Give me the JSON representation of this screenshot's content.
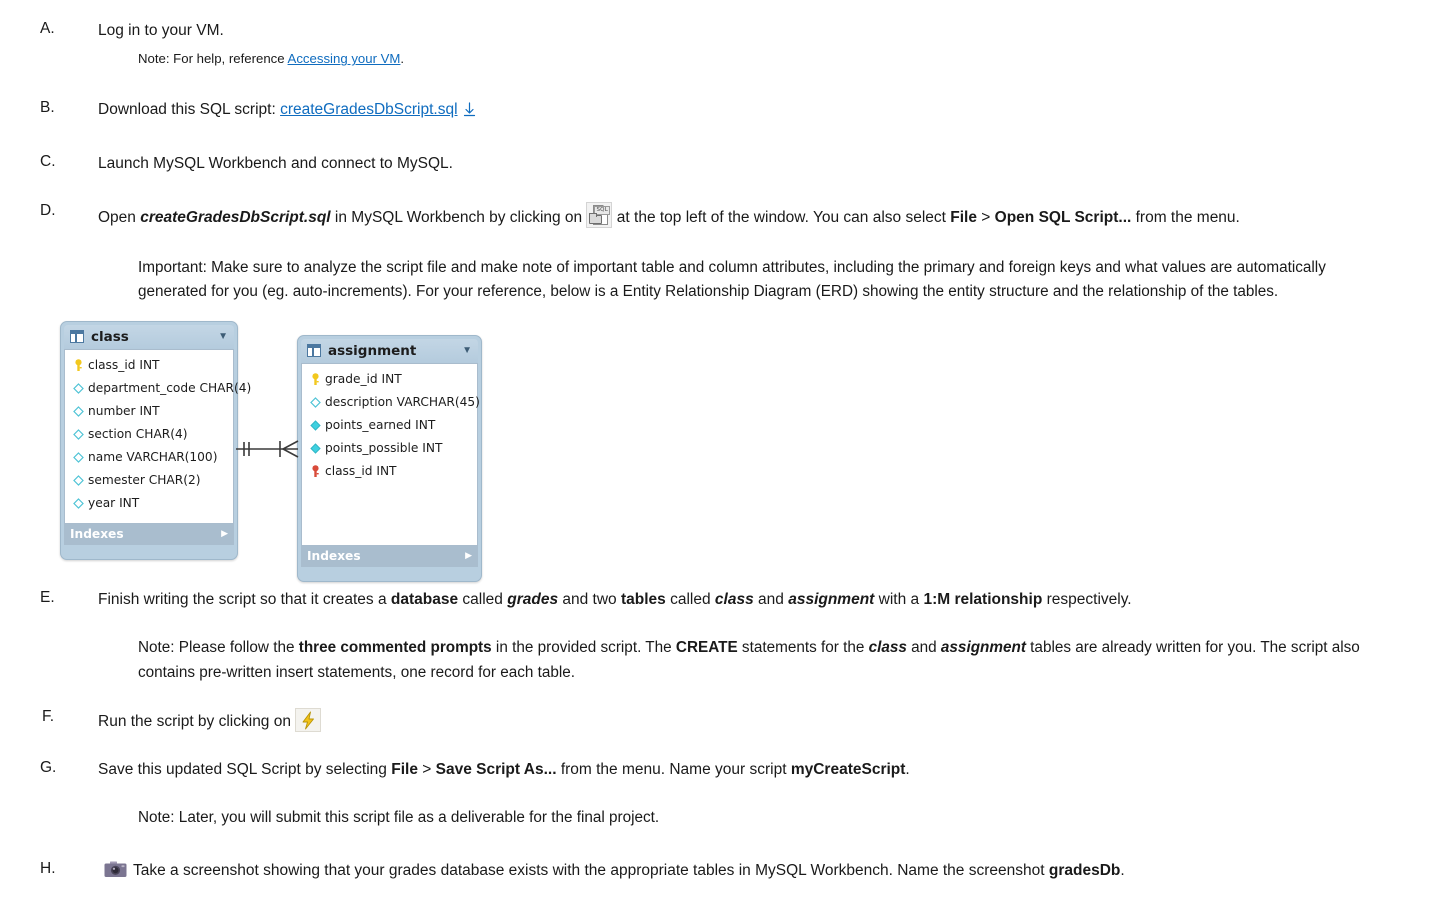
{
  "document": {
    "steps": [
      {
        "letter": "A.",
        "text": "Log in to your VM.",
        "note_prefix": "Note: For help, reference ",
        "note_link": "Accessing your VM",
        "note_suffix": "."
      },
      {
        "letter": "B.",
        "text_prefix": "Download this SQL script: ",
        "link": "createGradesDbScript.sql",
        "download_icon": "download-arrow-icon"
      },
      {
        "letter": "C.",
        "text": "Launch MySQL Workbench and connect to MySQL."
      },
      {
        "letter": "D.",
        "p1": "Open ",
        "file": "createGradesDbScript.sql",
        "p2": " in MySQL Workbench by clicking on ",
        "icon": "open-sql-script-icon",
        "p3": " at the top left of the window. You can also select ",
        "menu1": "File",
        "sep": " > ",
        "menu2": "Open SQL Script...",
        "p4": " from the menu.",
        "important": "Important: Make sure to analyze the script file and make note of important table and column attributes, including the primary and foreign keys and what values are automatically generated for you (eg. auto-increments). For your reference, below is a Entity Relationship Diagram (ERD) showing the entity structure and the relationship of the tables."
      },
      {
        "letter": "E.",
        "p1": "Finish writing the script so that it creates a ",
        "b1": "database",
        "p2": " called ",
        "i1": "grades",
        "p3": " and two ",
        "b2": "tables",
        "p4": " called ",
        "i2": "class",
        "p5": " and ",
        "i3": "assignment",
        "p6": " with a ",
        "b3": "1:M relationship",
        "p7": " respectively.",
        "note_p1": "Note: Please follow the ",
        "note_b1": "three commented prompts",
        "note_p2": " in the provided script. The ",
        "note_b2": "CREATE",
        "note_p3": " statements for the ",
        "note_i1": "class",
        "note_p4": " and ",
        "note_i2": "assignment",
        "note_p5": " tables are already written for you. The script also contains pre-written insert statements, one record for each table."
      },
      {
        "letter": "F.",
        "text": "Run the script by clicking on ",
        "icon": "run-script-lightning-icon"
      },
      {
        "letter": "G.",
        "p1": "Save this updated SQL Script by selecting ",
        "menu1": "File",
        "sep": " > ",
        "menu2": "Save Script As...",
        "p2": " from the menu. Name your script ",
        "b1": "myCreateScript",
        "p3": ".",
        "note": "Note: Later, you will submit this script file as a deliverable for the final project."
      },
      {
        "letter": "H.",
        "icon": "camera-icon",
        "p1": "Take a screenshot showing that your grades database exists with the appropriate tables in MySQL Workbench. Name the screenshot ",
        "b1": "gradesDb",
        "p2": "."
      }
    ]
  },
  "erd": {
    "relationship_notation": "one-to-many-crowsfoot",
    "tables": [
      {
        "name": "class",
        "caret": "▼",
        "indexes_label": "Indexes",
        "indexes_caret": "▶",
        "columns": [
          {
            "name": "class_id INT",
            "key": "primary"
          },
          {
            "name": "department_code CHAR(4)",
            "key": "nullable"
          },
          {
            "name": "number INT",
            "key": "nullable"
          },
          {
            "name": "section CHAR(4)",
            "key": "nullable"
          },
          {
            "name": "name VARCHAR(100)",
            "key": "nullable"
          },
          {
            "name": "semester CHAR(2)",
            "key": "nullable"
          },
          {
            "name": "year INT",
            "key": "nullable"
          }
        ]
      },
      {
        "name": "assignment",
        "caret": "▼",
        "indexes_label": "Indexes",
        "indexes_caret": "▶",
        "columns": [
          {
            "name": "grade_id INT",
            "key": "primary"
          },
          {
            "name": "description VARCHAR(45)",
            "key": "nullable"
          },
          {
            "name": "points_earned INT",
            "key": "notnull"
          },
          {
            "name": "points_possible INT",
            "key": "notnull"
          },
          {
            "name": "class_id INT",
            "key": "foreign"
          }
        ]
      }
    ]
  },
  "colors": {
    "link": "#0f6cbf",
    "erd_header": "#b8cfe0",
    "erd_border": "#9fb8cb",
    "erd_footer": "#a9bdce",
    "key_primary": "#f2c81e",
    "key_foreign": "#d94b3a",
    "diamond_notnull": "#3fd0e0",
    "bolt": "#f2c21a",
    "camera": "#7b7591"
  }
}
